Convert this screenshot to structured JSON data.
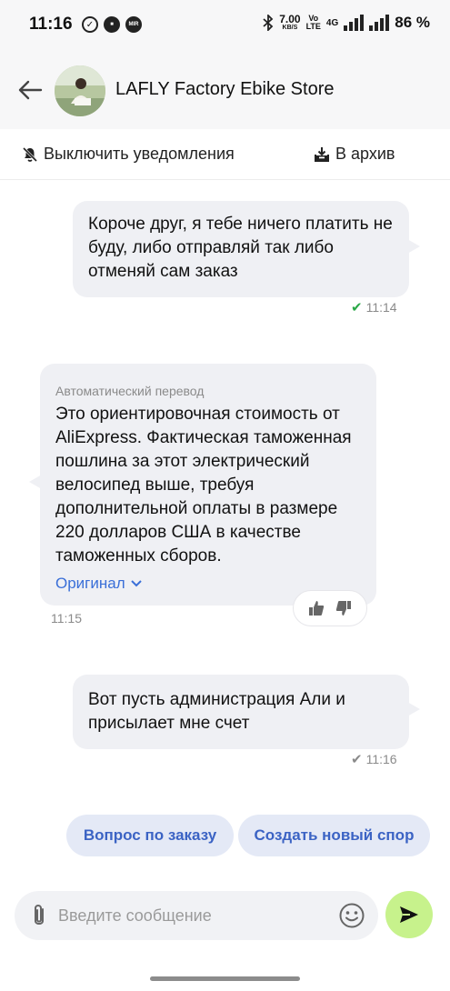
{
  "status_bar": {
    "time": "11:16",
    "speed": "7.00",
    "speed_unit": "KB/S",
    "volte_top": "Vo",
    "volte_bottom": "LTE",
    "net": "4G",
    "battery": "86 %"
  },
  "header": {
    "store_name": "LAFLY Factory Ebike Store"
  },
  "actions": {
    "mute_label": "Выключить уведомления",
    "archive_label": "В архив"
  },
  "messages": [
    {
      "text": "Короче друг, я тебе ничего платить не буду, либо отправляй так либо отменяй сам заказ",
      "time": "11:14"
    },
    {
      "auto_label": "Автоматический перевод",
      "text": "Это ориентировочная стоимость от AliExpress. Фактическая таможенная пошлина за этот электрический велосипед выше, требуя дополнительной оплаты в размере 220 долларов США в качестве таможенных сборов.",
      "original_link": "Оригинал",
      "time": "11:15"
    },
    {
      "text": "Вот пусть администрация Али и присылает мне счет",
      "time": "11:16"
    }
  ],
  "quick_replies": [
    "Вопрос по заказу",
    "Создать новый спор"
  ],
  "composer": {
    "placeholder": "Введите сообщение"
  },
  "colors": {
    "bubble": "#eff0f4",
    "send_button": "#c7f28c",
    "link": "#3a6fd8",
    "chip_bg": "#e4e9f6",
    "read_check": "#2aa847"
  }
}
